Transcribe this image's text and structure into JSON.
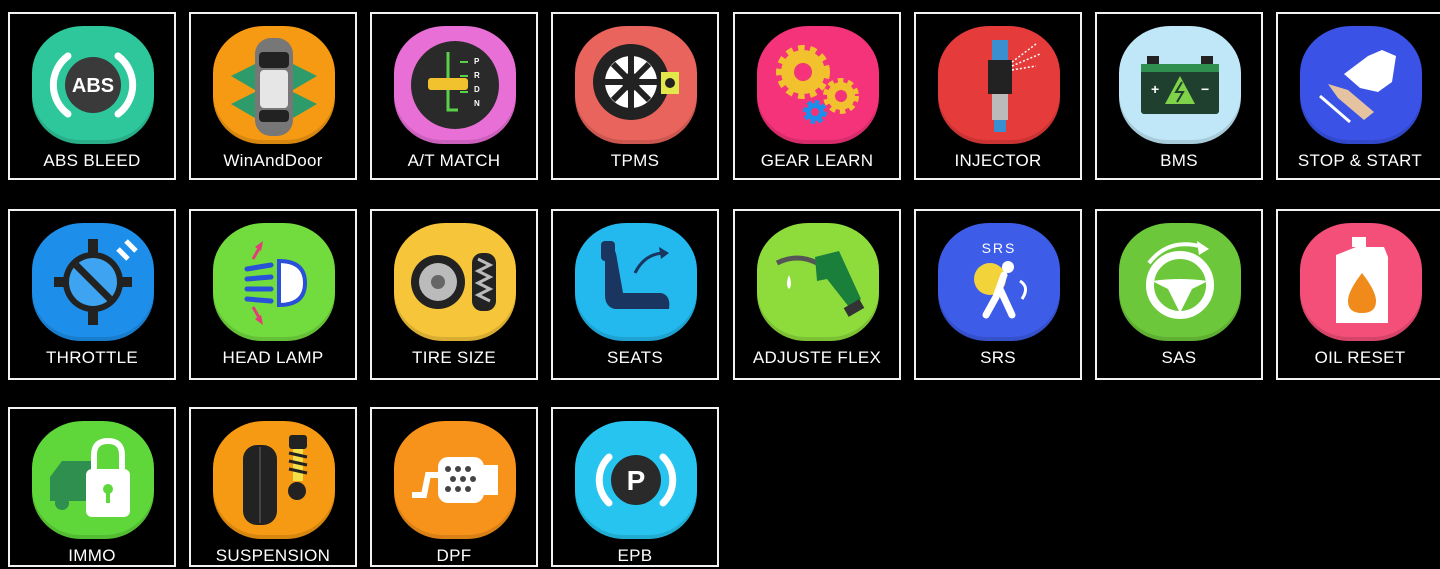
{
  "tiles": [
    {
      "label": "ABS BLEED",
      "icon": "abs-icon",
      "color": "#2ec79b"
    },
    {
      "label": "WinAndDoor",
      "icon": "car-doors-icon",
      "color": "#f59a12"
    },
    {
      "label": "A/T MATCH",
      "icon": "gear-shifter-icon",
      "color": "#e86fd6"
    },
    {
      "label": "TPMS",
      "icon": "tire-pressure-icon",
      "color": "#e8645c"
    },
    {
      "label": "GEAR LEARN",
      "icon": "gears-icon",
      "color": "#f4337a"
    },
    {
      "label": "INJECTOR",
      "icon": "injector-icon",
      "color": "#e53b3b"
    },
    {
      "label": "BMS",
      "icon": "battery-icon",
      "color": "#bfe7f7"
    },
    {
      "label": "STOP & START",
      "icon": "pedal-icon",
      "color": "#3a52e6"
    },
    {
      "label": "THROTTLE",
      "icon": "throttle-icon",
      "color": "#1d8fea"
    },
    {
      "label": "HEAD LAMP",
      "icon": "headlamp-icon",
      "color": "#72db3e"
    },
    {
      "label": "TIRE SIZE",
      "icon": "tire-size-icon",
      "color": "#f6c53a"
    },
    {
      "label": "SEATS",
      "icon": "seat-icon",
      "color": "#23b9ee"
    },
    {
      "label": "ADJUSTE FLEX",
      "icon": "fuel-nozzle-icon",
      "color": "#8edc3c"
    },
    {
      "label": "SRS",
      "icon": "airbag-icon",
      "color": "#3d5ce8"
    },
    {
      "label": "SAS",
      "icon": "steering-wheel-icon",
      "color": "#6cc83a"
    },
    {
      "label": "OIL RESET",
      "icon": "oil-can-icon",
      "color": "#f44f78"
    },
    {
      "label": "IMMO",
      "icon": "immo-lock-icon",
      "color": "#5fd63a"
    },
    {
      "label": "SUSPENSION",
      "icon": "suspension-icon",
      "color": "#f59a12"
    },
    {
      "label": "DPF",
      "icon": "dpf-icon",
      "color": "#f7921a"
    },
    {
      "label": "EPB",
      "icon": "parking-brake-icon",
      "color": "#26c4ee"
    }
  ],
  "icon_text": {
    "abs": "ABS",
    "prnd_p": "P",
    "prnd_r": "R",
    "prnd_d": "D",
    "prnd_n": "N",
    "srs": "SRS",
    "epb": "P",
    "bms_plus": "+",
    "bms_minus": "−"
  }
}
